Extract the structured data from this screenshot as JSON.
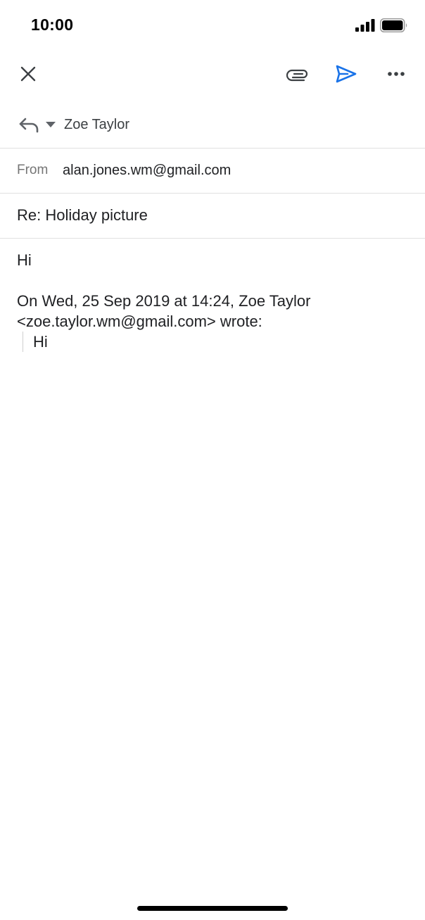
{
  "status_bar": {
    "time": "10:00",
    "signal_icon": "cellular-signal-icon",
    "battery_icon": "battery-icon"
  },
  "toolbar": {
    "close_icon": "close-icon",
    "attach_icon": "paperclip-icon",
    "send_icon": "send-icon",
    "more_icon": "more-horizontal-icon",
    "accent_color": "#1a73e8"
  },
  "reply": {
    "icon": "reply-icon",
    "dropdown_icon": "dropdown-triangle-icon",
    "recipient": "Zoe Taylor"
  },
  "from": {
    "label": "From",
    "value": "alan.jones.wm@gmail.com"
  },
  "subject": {
    "value": "Re: Holiday picture"
  },
  "body": {
    "greeting": "Hi",
    "quote_header": "On Wed, 25 Sep 2019 at 14:24, Zoe Taylor <zoe.taylor.wm@gmail.com> wrote:",
    "quoted_text": "Hi"
  }
}
